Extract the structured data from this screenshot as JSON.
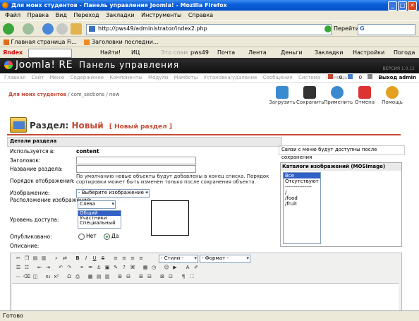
{
  "window": {
    "title": "Для моих студентов - Панель управления Joomla! - Mozilla Firefox"
  },
  "menu": [
    "Файл",
    "Правка",
    "Вид",
    "Переход",
    "Закладки",
    "Инструменты",
    "Справка"
  ],
  "nav": {
    "url": "http://pws49/administrator/index2.php",
    "go_label": "Перейти",
    "search_placeholder": "G"
  },
  "bookmarks": [
    "Главная страница Fi...",
    "Заголовки последни..."
  ],
  "yandex_bar": {
    "brand": "Яndex",
    "find": "Найти!",
    "ic": "ИЦ",
    "spam": "Это спам",
    "pws": "pws49",
    "mail": "Почта",
    "feed": "Лента",
    "money": "Деньги",
    "bookmarks": "Закладки",
    "settings": "Настройки",
    "weather": "Погода"
  },
  "joomla": {
    "logo": "Joomla! RE",
    "panel_title": "Панель управления",
    "version": "ВЕРСИЯ 1.0.12",
    "admin_menu": [
      "Главная",
      "Сайт",
      "Меню",
      "Содержимое",
      "Компоненты",
      "Модули",
      "Мамботы",
      "Установка/удаление",
      "Сообщения",
      "Система",
      "Помощь"
    ],
    "msg_count1": "0",
    "msg_count2": "0",
    "logout": "Выход admin",
    "breadcrumb": {
      "site": "Для моих студентов",
      "rest": " / com_sections / new"
    },
    "toolbar": [
      "Загрузить",
      "Сохранить",
      "Применить",
      "Отмена",
      "Помощь"
    ],
    "heading": {
      "label": "Раздел:",
      "status": "Новый",
      "sub": "[ Новый раздел ]"
    },
    "details_header": "Детали раздела",
    "fields": {
      "used_in_label": "Используется в:",
      "used_in_value": "content",
      "title_label": "Заголовок:",
      "name_label": "Название раздела:",
      "order_label": "Порядок отображения:",
      "order_note": "По умолчанию новые объекты будут добавлены в конец списка. Порядок сортировки может быть изменен только после сохранения объекта.",
      "image_label": "Изображение:",
      "image_select": "- Выберите изображение -",
      "image_pos_label": "Расположение изображения:",
      "image_pos_value": "Слева",
      "access_label": "Уровень доступа:",
      "access_options": [
        "Общий",
        "Участники",
        "Специальный"
      ],
      "published_label": "Опубликовано:",
      "published_no": "Нет",
      "published_yes": "Да",
      "description_label": "Описание:"
    },
    "menu_note": "Связи с меню будут доступны после сохранения",
    "image_panel": {
      "title": "Каталоги изображений (MOSImage)",
      "options": [
        "Все",
        "Отсутствуют",
        "---------------",
        "/",
        "/food",
        "/fruit"
      ]
    },
    "editor": {
      "style_select": "- Стили -",
      "format_select": "- Формат -"
    }
  },
  "status": "Готово"
}
